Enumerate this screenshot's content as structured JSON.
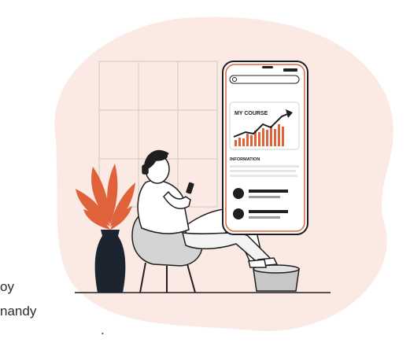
{
  "edge_text": {
    "line1": "oy",
    "line2": "nandy",
    "line3": "."
  },
  "phone": {
    "chart_title": "MY COURSE",
    "section_label": "INFORMATION"
  },
  "colors": {
    "blob": "#fbe9e4",
    "accent": "#e0623a",
    "outline": "#1f1f1f",
    "vase": "#1c2430",
    "gray": "#c7c7c7"
  }
}
